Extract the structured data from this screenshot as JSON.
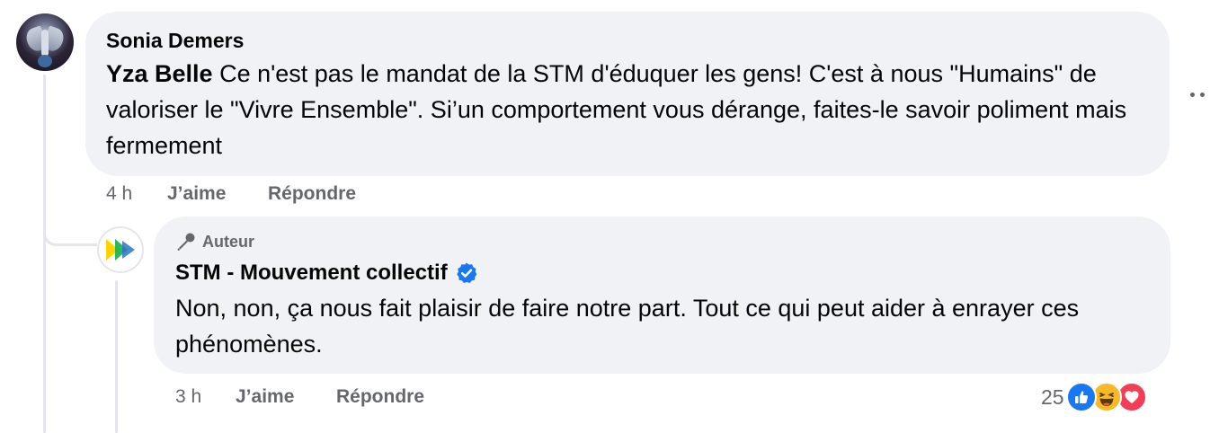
{
  "comment": {
    "author": "Sonia Demers",
    "mention": "Yza Belle",
    "text": " Ce n'est pas le mandat de la STM d'éduquer les gens! C'est à nous \"Humains\" de valoriser le \"Vivre Ensemble\". Si’un comportement vous dérange, faites-le savoir poliment mais fermement",
    "time": "4 h",
    "like_label": "J’aime",
    "reply_label": "Répondre"
  },
  "reply": {
    "badge": "Auteur",
    "author": "STM - Mouvement collectif",
    "verified": true,
    "text": "Non, non, ça nous fait plaisir de faire notre part. Tout ce qui peut aider à enrayer ces phénomènes.",
    "time": "3 h",
    "like_label": "J’aime",
    "reply_label": "Répondre",
    "reaction_count": "25",
    "reactions": [
      "like-icon",
      "haha-icon",
      "love-icon"
    ]
  },
  "colors": {
    "bubble": "#f0f2f5",
    "meta_text": "#65676b",
    "like_blue": "#1877f2",
    "haha_yellow": "#f7b928",
    "love_red": "#f33e58",
    "stm_yellow": "#ffd200",
    "stm_green": "#16b04a",
    "stm_blue": "#2b74c7"
  }
}
